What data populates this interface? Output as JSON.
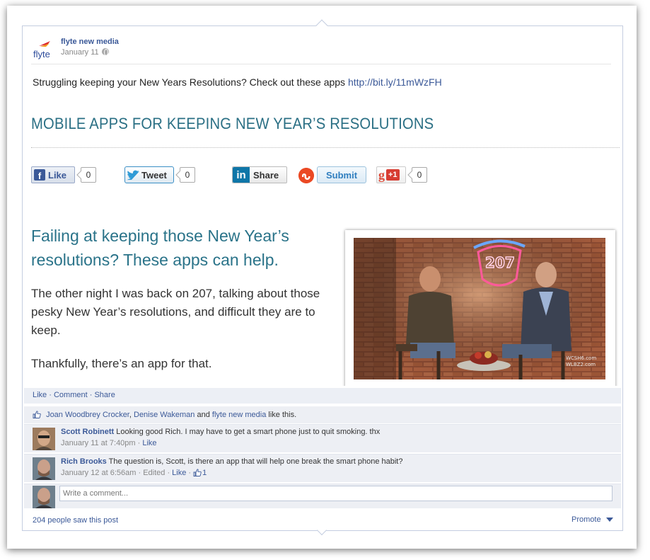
{
  "post": {
    "page_name": "flyte new media",
    "date": "January 11",
    "logo_text": "flyte",
    "text": "Struggling keeping your New Years Resolutions? Check out these apps",
    "link": "http://bit.ly/11mWzFH"
  },
  "preview": {
    "title": "MOBILE APPS FOR KEEPING NEW YEAR’S RESOLUTIONS",
    "subheading": "Failing at keeping those New Year’s resolutions? These apps can help.",
    "paragraphs": [
      "The other night I was back on 207, talking about those pesky New Year’s resolutions, and difficult they are to keep.",
      "Thankfully, there’s an app for that."
    ],
    "video_watermark": [
      "WCSH6.com",
      "WLBZ2.com"
    ],
    "video_sign": "207"
  },
  "share_buttons": {
    "like_label": "Like",
    "like_count": "0",
    "tweet_label": "Tweet",
    "tweet_count": "0",
    "linkedin_icon": "in",
    "linkedin_label": "Share",
    "submit_label": "Submit",
    "gplus_letter": "g",
    "gplus_label": "+1",
    "gplus_count": "0"
  },
  "ufi": {
    "actions": [
      "Like",
      "Comment",
      "Share"
    ],
    "likers": [
      "Joan Woodbrey Crocker",
      "Denise Wakeman",
      "flyte new media"
    ],
    "likes_joiner_1": ",",
    "likes_joiner_2": "and",
    "likes_suffix": "like this.",
    "comments": [
      {
        "author": "Scott Robinett",
        "text": "Looking good Rich. I may have to get a smart phone just to quit smoking. thx",
        "time": "January 11 at 7:40pm",
        "like": "Like"
      },
      {
        "author": "Rich Brooks",
        "text": "The question is, Scott, is there an app that will help one break the smart phone habit?",
        "time": "January 12 at 6:56am",
        "edited": "Edited",
        "like": "Like",
        "like_count": "1"
      }
    ],
    "write_placeholder": "Write a comment...",
    "seen_text": "204 people saw this post",
    "promote_label": "Promote"
  },
  "colors": {
    "facebook_blue": "#3b5998",
    "title_teal": "#2a6f84",
    "ufi_background": "#edeff4"
  }
}
